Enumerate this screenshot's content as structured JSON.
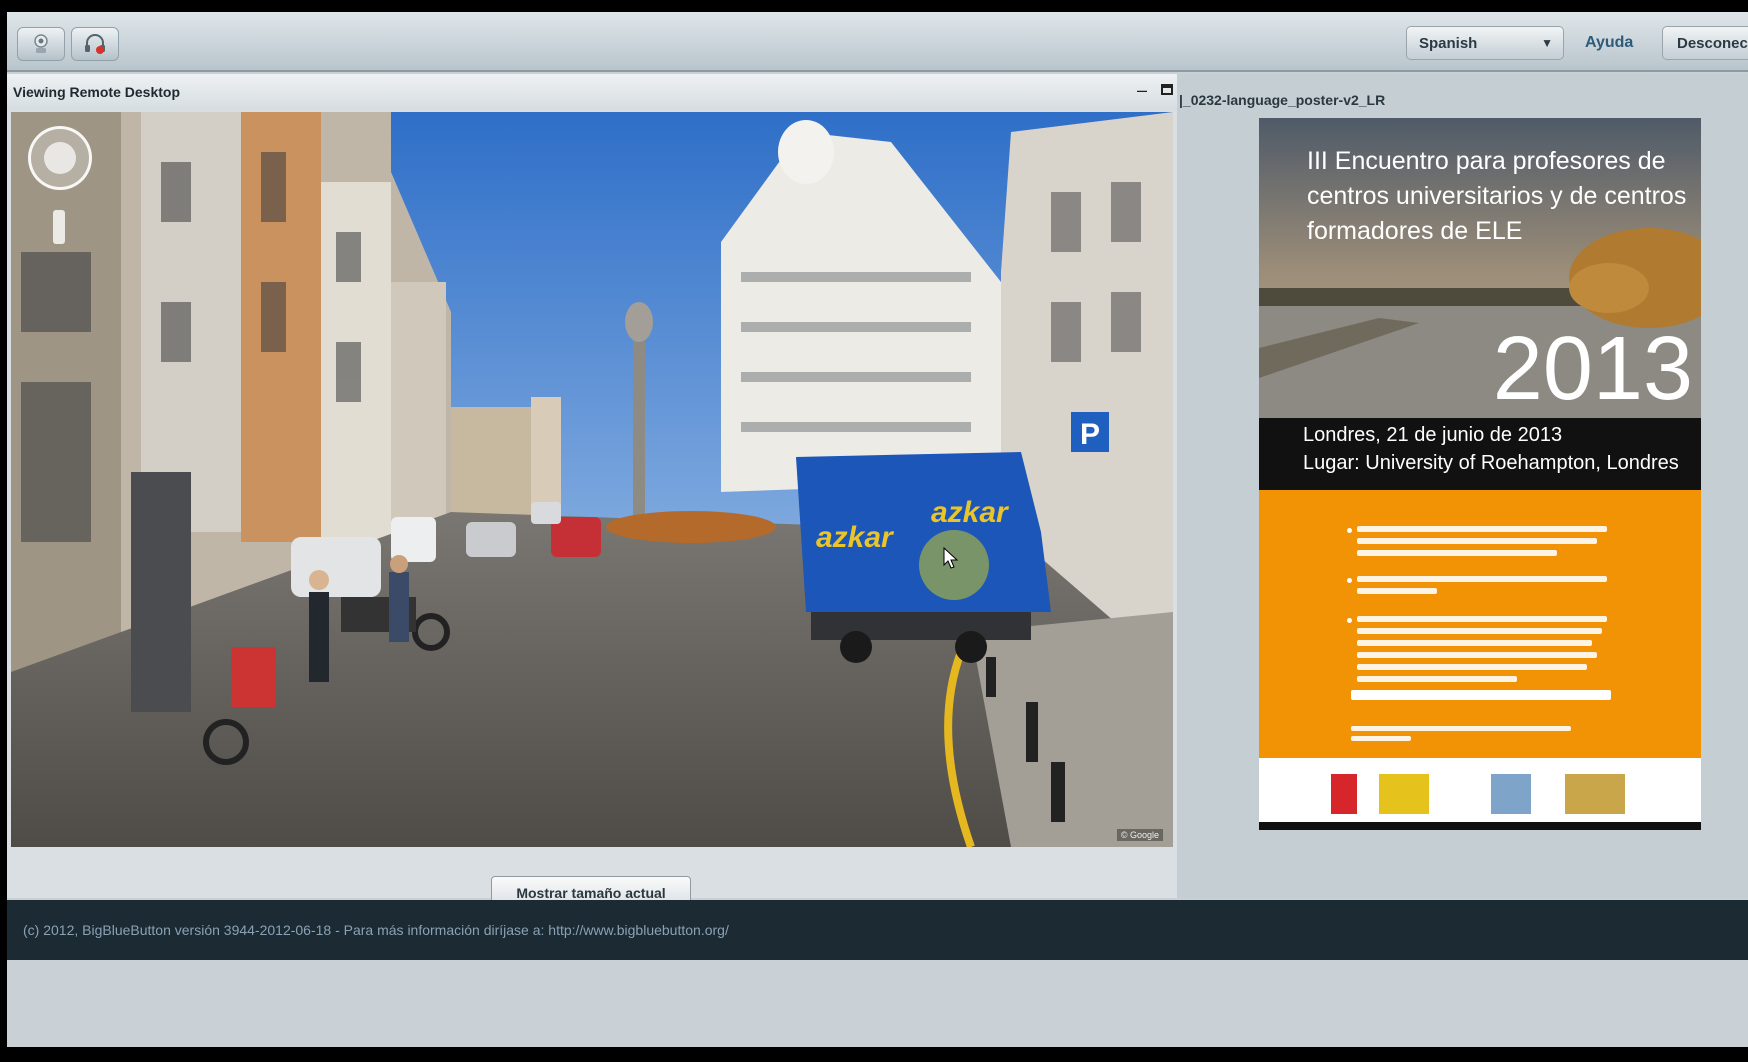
{
  "toolbar": {
    "language_selected": "Spanish",
    "help_label": "Ayuda",
    "disconnect_label": "Desconec"
  },
  "remote_desktop": {
    "title": "Viewing Remote Desktop",
    "show_actual_size_label": "Mostrar tamaño actual",
    "view_content": "street-view-photo"
  },
  "presentation": {
    "title": "|_0232-language_poster-v2_LR",
    "poster": {
      "heading": "III Encuentro para profesores de centros universitarios y de centros formadores de ELE",
      "year": "2013",
      "date": "Londres, 21 de junio de 2013",
      "venue": "Lugar: University of Roehampton, Londres"
    }
  },
  "footer": {
    "text": "(c) 2012, BigBlueButton versión 3944-2012-06-18 - Para más información diríjase a: http://www.bigbluebutton.org/"
  },
  "colors": {
    "poster_orange": "#f29205",
    "footer_bg": "#1b2a33",
    "toolbar_bg": "#c9d1d6"
  },
  "icons": {
    "toolbar": [
      "webcam-icon",
      "headset-icon"
    ],
    "view": [
      "pan-control-icon",
      "zoom-slider-icon",
      "mouse-pointer-icon"
    ]
  }
}
